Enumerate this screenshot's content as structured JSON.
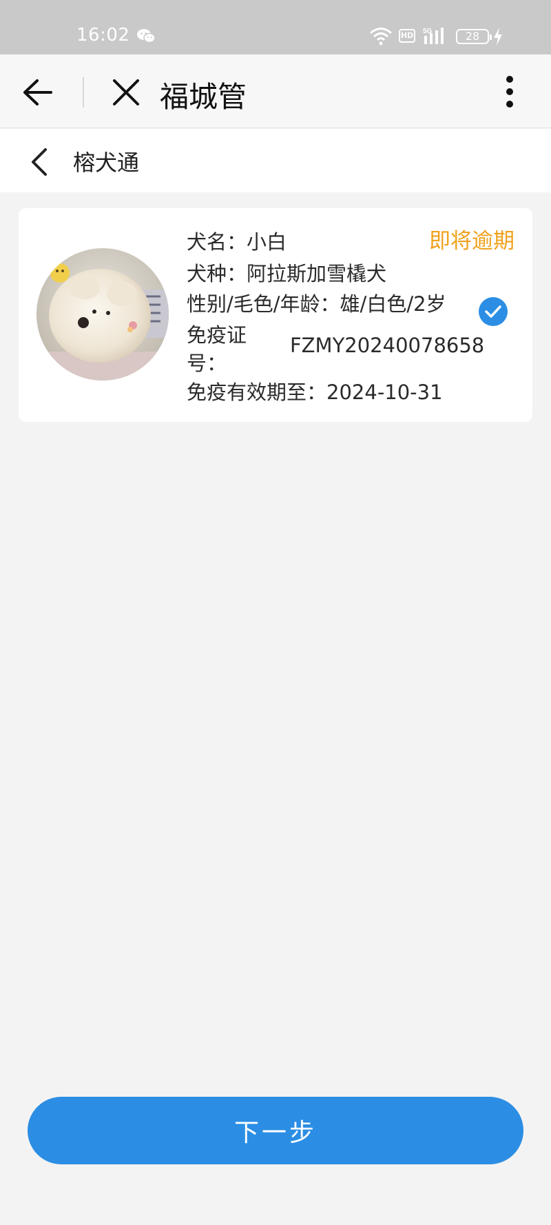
{
  "status_bar": {
    "time": "16:02",
    "hd": "HD",
    "network": "5G",
    "battery": "28"
  },
  "app_bar": {
    "title": "福城管"
  },
  "sub_bar": {
    "title": "榕犬通"
  },
  "dog_card": {
    "status": "即将逾期",
    "name_label": "犬名：",
    "name_value": "小白",
    "breed_label": "犬种：",
    "breed_value": "阿拉斯加雪橇犬",
    "attrs_label": "性别/毛色/年龄：",
    "attrs_value": "雄/白色/2岁",
    "cert_label": "免疫证号：",
    "cert_value": "FZMY20240078658",
    "expiry_label": "免疫有效期至：",
    "expiry_value": "2024-10-31",
    "selected": true
  },
  "actions": {
    "next_label": "下一步"
  },
  "colors": {
    "accent": "#2b8ee4",
    "warning": "#f0a11b",
    "status_bar_bg": "#c9c9c9"
  }
}
